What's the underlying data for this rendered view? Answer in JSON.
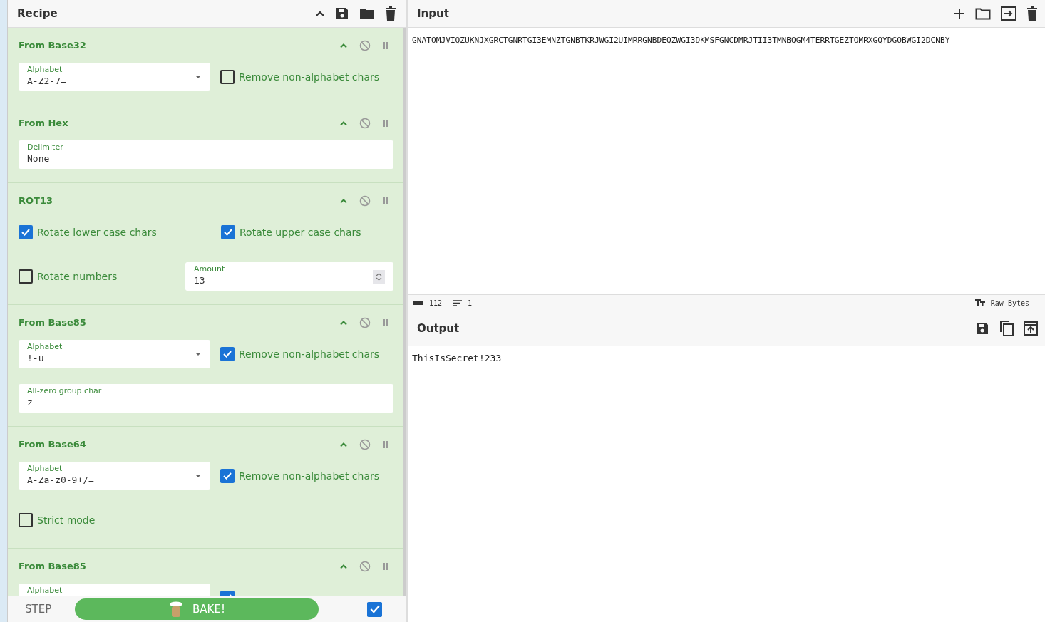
{
  "recipe": {
    "title": "Recipe",
    "operations": [
      {
        "title": "From Base32",
        "rows": [
          [
            {
              "kind": "select",
              "label": "Alphabet",
              "value": "A-Z2-7="
            },
            {
              "kind": "checkbox",
              "label": "Remove non-alphabet chars",
              "checked": false
            }
          ]
        ]
      },
      {
        "title": "From Hex",
        "rows": [
          [
            {
              "kind": "text",
              "label": "Delimiter",
              "value": "None"
            }
          ]
        ]
      },
      {
        "title": "ROT13",
        "rows": [
          [
            {
              "kind": "checkbox",
              "label": "Rotate lower case chars",
              "checked": true
            },
            {
              "kind": "checkbox",
              "label": "Rotate upper case chars",
              "checked": true
            }
          ],
          [
            {
              "kind": "checkbox",
              "label": "Rotate numbers",
              "checked": false
            },
            {
              "kind": "number",
              "label": "Amount",
              "value": "13"
            }
          ]
        ]
      },
      {
        "title": "From Base85",
        "rows": [
          [
            {
              "kind": "select",
              "label": "Alphabet",
              "value": "!-u"
            },
            {
              "kind": "checkbox",
              "label": "Remove non-alphabet chars",
              "checked": true
            }
          ],
          [
            {
              "kind": "text",
              "label": "All-zero group char",
              "value": "z"
            }
          ]
        ]
      },
      {
        "title": "From Base64",
        "rows": [
          [
            {
              "kind": "select",
              "label": "Alphabet",
              "value": "A-Za-z0-9+/="
            },
            {
              "kind": "checkbox",
              "label": "Remove non-alphabet chars",
              "checked": true
            }
          ],
          [
            {
              "kind": "checkbox",
              "label": "Strict mode",
              "checked": false
            }
          ]
        ]
      },
      {
        "title": "From Base85",
        "rows": [
          [
            {
              "kind": "select",
              "label": "Alphabet"
            },
            {
              "kind": "checkbox",
              "checked": true
            }
          ]
        ]
      }
    ],
    "step_label": "STEP",
    "bake_label": "BAKE!",
    "auto_bake": {
      "checked": true
    }
  },
  "input": {
    "title": "Input",
    "text": "GNATOMJVIQZUKNJXGRCTGNRTGI3EMNZTGNBTKRJWGI2UIMRRGNBDEQZWGI3DKMSFGNCDMRJTII3TMNBQGM4TERRTGEZTOMRXGQYDGOBWGI2DCNBY"
  },
  "status": {
    "length": "112",
    "lines": "1",
    "format": "Raw Bytes"
  },
  "output": {
    "title": "Output",
    "text": "ThisIsSecret!233"
  }
}
